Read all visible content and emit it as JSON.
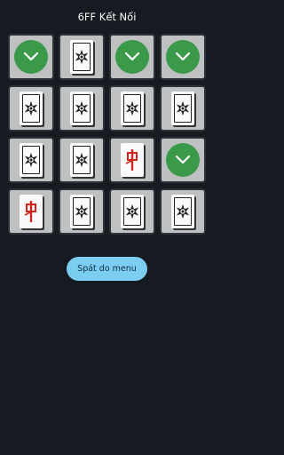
{
  "header": {
    "title": "6FF Kết Nối"
  },
  "board": {
    "tiles": [
      {
        "state": "matched"
      },
      {
        "state": "back"
      },
      {
        "state": "matched"
      },
      {
        "state": "matched"
      },
      {
        "state": "back"
      },
      {
        "state": "back"
      },
      {
        "state": "back"
      },
      {
        "state": "back"
      },
      {
        "state": "back"
      },
      {
        "state": "back"
      },
      {
        "state": "face",
        "glyph": "red-dragon-icon"
      },
      {
        "state": "matched"
      },
      {
        "state": "face",
        "glyph": "red-dragon-icon"
      },
      {
        "state": "back"
      },
      {
        "state": "back"
      },
      {
        "state": "back"
      }
    ]
  },
  "footer": {
    "back_button_label": "Spát do menu"
  },
  "colors": {
    "background": "#151b20",
    "check": "#3a9a4a",
    "button": "#7ccdf2",
    "dragon": "#d0261e"
  }
}
